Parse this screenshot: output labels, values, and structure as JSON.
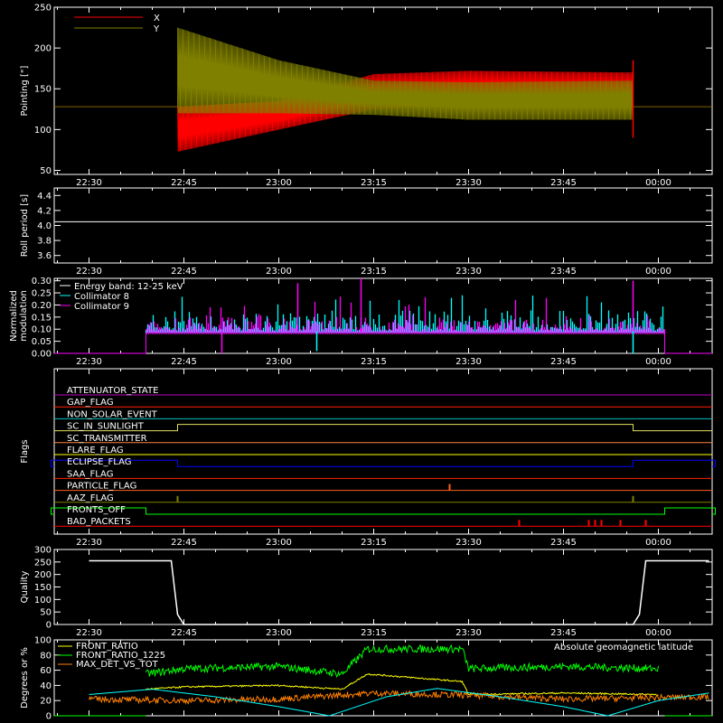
{
  "chart_data": [
    {
      "id": "pointing",
      "type": "line",
      "ylabel": "Pointing [\"]",
      "ylim": [
        45,
        250
      ],
      "yticks": [
        50,
        100,
        150,
        200,
        250
      ],
      "x_ticks": [
        "22:30",
        "22:45",
        "23:00",
        "23:15",
        "23:30",
        "23:45",
        "00:00"
      ],
      "legend": [
        {
          "name": "X",
          "color": "#ff0000"
        },
        {
          "name": "Y",
          "color": "#808000"
        }
      ],
      "series": [
        {
          "name": "X",
          "color": "#ff0000",
          "baseline": 128,
          "envelope": [
            {
              "t": "22:44",
              "lo": 73,
              "hi": 128
            },
            {
              "t": "23:00",
              "lo": 100,
              "hi": 135
            },
            {
              "t": "23:15",
              "lo": 125,
              "hi": 168
            },
            {
              "t": "23:30",
              "lo": 130,
              "hi": 172
            },
            {
              "t": "23:56",
              "lo": 128,
              "hi": 170
            }
          ]
        },
        {
          "name": "Y",
          "color": "#808000",
          "baseline": 128,
          "envelope": [
            {
              "t": "22:44",
              "lo": 120,
              "hi": 225
            },
            {
              "t": "23:00",
              "lo": 120,
              "hi": 185
            },
            {
              "t": "23:15",
              "lo": 118,
              "hi": 160
            },
            {
              "t": "23:30",
              "lo": 112,
              "hi": 158
            },
            {
              "t": "23:56",
              "lo": 112,
              "hi": 160
            }
          ]
        }
      ]
    },
    {
      "id": "roll",
      "type": "line",
      "ylabel": "Roll period [s]",
      "ylim": [
        3.5,
        4.5
      ],
      "yticks": [
        "3.6",
        "3.8",
        "4.0",
        "4.2",
        "4.4"
      ],
      "x_ticks": [
        "22:30",
        "22:45",
        "23:00",
        "23:15",
        "23:30",
        "23:45",
        "00:00"
      ],
      "series": [
        {
          "name": "roll",
          "color": "#ffffff",
          "value": 4.05
        }
      ]
    },
    {
      "id": "modulation",
      "type": "bar",
      "ylabel": "Normalized modulation",
      "ylim": [
        0,
        0.31
      ],
      "yticks": [
        "0.00",
        "0.05",
        "0.10",
        "0.15",
        "0.20",
        "0.25",
        "0.30"
      ],
      "x_ticks": [
        "22:30",
        "22:45",
        "23:00",
        "23:15",
        "23:30",
        "23:45",
        "00:00"
      ],
      "legend": [
        {
          "name": "Energy band: 12-25 keV",
          "color": "#ffffff"
        },
        {
          "name": "Collimator 8",
          "color": "#00ffff"
        },
        {
          "name": "Collimator 9",
          "color": "#ff00ff"
        }
      ],
      "series": [
        {
          "name": "Collimator 8",
          "color": "#00ffff",
          "range": [
            "22:39",
            "00:01"
          ],
          "baseline": 0.095
        },
        {
          "name": "Collimator 9",
          "color": "#ff00ff",
          "range": [
            "22:39",
            "00:01"
          ],
          "baseline": 0.09
        }
      ]
    },
    {
      "id": "flags",
      "type": "line",
      "ylabel": "Flags",
      "x_ticks": [
        "22:30",
        "22:45",
        "23:00",
        "23:15",
        "23:30",
        "23:45",
        "00:00"
      ],
      "flags": [
        {
          "name": "ATTENUATOR_STATE",
          "color": "#c000c0",
          "steps": []
        },
        {
          "name": "GAP_FLAG",
          "color": "#ff2000",
          "steps": []
        },
        {
          "name": "NON_SOLAR_EVENT",
          "color": "#00c0c0",
          "steps": []
        },
        {
          "name": "SC_IN_SUNLIGHT",
          "color": "#e0e060",
          "steps": [
            [
              "22:44",
              "23:56"
            ]
          ]
        },
        {
          "name": "SC_TRANSMITTER",
          "color": "#ff8040",
          "steps": []
        },
        {
          "name": "FLARE_FLAG",
          "color": "#ffff00",
          "steps": []
        },
        {
          "name": "ECLIPSE_FLAG",
          "color": "#0000ff",
          "steps": [
            [
              "22:30",
              "22:44"
            ],
            [
              "23:56",
              "00:08"
            ]
          ]
        },
        {
          "name": "SAA_FLAG",
          "color": "#ff2000",
          "steps": []
        },
        {
          "name": "PARTICLE_FLAG",
          "color": "#ff6020",
          "spikes": [
            "23:27"
          ]
        },
        {
          "name": "AAZ_FLAG",
          "color": "#808000",
          "spikes": [
            "22:44",
            "23:56"
          ]
        },
        {
          "name": "FRONTS_OFF",
          "color": "#00ff00",
          "steps": [
            [
              "22:30",
              "22:39"
            ],
            [
              "00:01",
              "00:08"
            ]
          ]
        },
        {
          "name": "BAD_PACKETS",
          "color": "#ff0000",
          "spikes": [
            "23:38",
            "23:49",
            "23:50",
            "23:51",
            "23:54",
            "23:58"
          ]
        }
      ]
    },
    {
      "id": "quality",
      "type": "line",
      "ylabel": "Quality",
      "ylim": [
        0,
        300
      ],
      "yticks": [
        0,
        50,
        100,
        150,
        200,
        250,
        300
      ],
      "x_ticks": [
        "22:30",
        "22:45",
        "23:00",
        "23:15",
        "23:30",
        "23:45",
        "00:00"
      ],
      "series": [
        {
          "name": "quality",
          "color": "#ffffff",
          "points": [
            [
              "22:30",
              255
            ],
            [
              "22:43",
              255
            ],
            [
              "22:44",
              40
            ],
            [
              "22:45",
              0
            ],
            [
              "23:56",
              0
            ],
            [
              "23:57",
              40
            ],
            [
              "23:58",
              255
            ],
            [
              "00:08",
              255
            ]
          ]
        }
      ]
    },
    {
      "id": "ratios",
      "type": "line",
      "ylabel": "Degrees or %",
      "ylim": [
        0,
        100
      ],
      "yticks": [
        0,
        20,
        40,
        60,
        80,
        100
      ],
      "x_ticks": [
        "22:30",
        "22:45",
        "23:00",
        "23:15",
        "23:30",
        "23:45",
        "00:00"
      ],
      "legend": [
        {
          "name": "FRONT_RATIO",
          "color": "#ffff00"
        },
        {
          "name": "FRONT_RATIO_1225",
          "color": "#00ff00"
        },
        {
          "name": "MAX_DET_VS_TOT",
          "color": "#ff8000"
        }
      ],
      "annotation": {
        "text": "Absolute geomagnetic latitude",
        "color": "#00ffff"
      },
      "series": [
        {
          "name": "FRONT_RATIO_1225",
          "color": "#00ff00",
          "points": [
            [
              "22:39",
              55
            ],
            [
              "22:45",
              62
            ],
            [
              "23:00",
              65
            ],
            [
              "23:10",
              55
            ],
            [
              "23:14",
              88
            ],
            [
              "23:29",
              88
            ],
            [
              "23:30",
              62
            ],
            [
              "23:45",
              65
            ],
            [
              "00:00",
              62
            ]
          ]
        },
        {
          "name": "FRONT_RATIO",
          "color": "#ffff00",
          "points": [
            [
              "22:39",
              35
            ],
            [
              "22:45",
              38
            ],
            [
              "23:00",
              40
            ],
            [
              "23:10",
              35
            ],
            [
              "23:14",
              55
            ],
            [
              "23:29",
              45
            ],
            [
              "23:30",
              28
            ],
            [
              "23:45",
              30
            ],
            [
              "00:00",
              28
            ]
          ]
        },
        {
          "name": "MAX_DET_VS_TOT",
          "color": "#ff8000",
          "points": [
            [
              "22:30",
              22
            ],
            [
              "22:45",
              20
            ],
            [
              "23:00",
              22
            ],
            [
              "23:15",
              30
            ],
            [
              "23:30",
              27
            ],
            [
              "23:45",
              22
            ],
            [
              "00:08",
              25
            ]
          ]
        },
        {
          "name": "Absolute geomagnetic latitude",
          "color": "#00ffff",
          "points": [
            [
              "22:30",
              28
            ],
            [
              "22:40",
              35
            ],
            [
              "22:50",
              25
            ],
            [
              "23:00",
              12
            ],
            [
              "23:08",
              0
            ],
            [
              "23:17",
              25
            ],
            [
              "23:25",
              36
            ],
            [
              "23:35",
              25
            ],
            [
              "23:45",
              12
            ],
            [
              "23:52",
              0
            ],
            [
              "00:00",
              20
            ],
            [
              "00:08",
              30
            ]
          ]
        }
      ]
    }
  ]
}
